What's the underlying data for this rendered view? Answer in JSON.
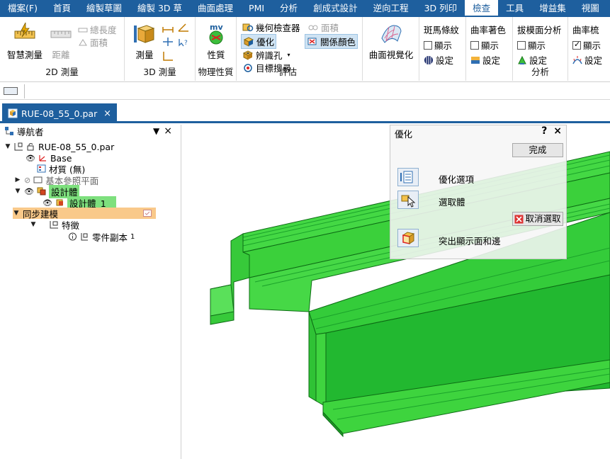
{
  "menu": {
    "items": [
      "檔案(F)",
      "首頁",
      "繪製草圖",
      "繪製 3D 草",
      "曲面處理",
      "PMI",
      "分析",
      "創成式設計",
      "逆向工程",
      "3D 列印",
      "檢查",
      "工具",
      "增益集",
      "視圖"
    ],
    "active_index": 10
  },
  "ribbon": {
    "measure2d": {
      "smart_measure": "智慧測量",
      "distance": "距離",
      "total_length": "總長度",
      "area": "面積",
      "group": "2D 測量"
    },
    "measure3d": {
      "measure": "測量",
      "group": "3D 測量"
    },
    "physical": {
      "icon_text": "mv",
      "properties": "性質",
      "group": "物理性質"
    },
    "evaluate": {
      "geometry_inspector": "幾何檢查器",
      "area": "面積",
      "optimize": "優化",
      "relation_colors": "關係顏色",
      "identify_holes": "辨識孔",
      "target_search": "目標搜尋",
      "group": "評估"
    },
    "surface_vis": {
      "label": "曲面視覺化"
    },
    "zebra": {
      "title": "斑馬條紋",
      "show": "顯示",
      "settings": "設定"
    },
    "curvature_shading": {
      "title": "曲率著色",
      "show": "顯示",
      "settings": "設定"
    },
    "draft_analysis": {
      "title": "拔模面分析",
      "show": "顯示",
      "settings": "設定",
      "group": "分析"
    },
    "curvature_comb": {
      "title": "曲率梳",
      "show": "顯示",
      "settings": "設定",
      "show_checked": true
    }
  },
  "document": {
    "tab_name": "RUE-08_55_0.par",
    "close_glyph": "×"
  },
  "navigator": {
    "title": "導航者",
    "root": "RUE-08_55_0.par",
    "base": "Base",
    "material": "材質 (無)",
    "ref_planes": "基本參照平面",
    "design_body": "設計體",
    "design_body_1": "設計體_1",
    "sync_modeling": "同步建模",
    "features": "特徵",
    "part_copy": "零件副本",
    "part_copy_suffix": "1"
  },
  "dialog": {
    "title": "優化",
    "help": "?",
    "close": "×",
    "done": "完成",
    "options": "優化選項",
    "select_body": "選取體",
    "deselect": "取消選取",
    "highlight": "突出顯示面和邊"
  },
  "colors": {
    "brand": "#1e5f9e",
    "model_green": "#2ecc40",
    "model_dark": "#1a9a26",
    "selection_green": "#7ee07e",
    "selection_orange": "#f9c98a"
  }
}
